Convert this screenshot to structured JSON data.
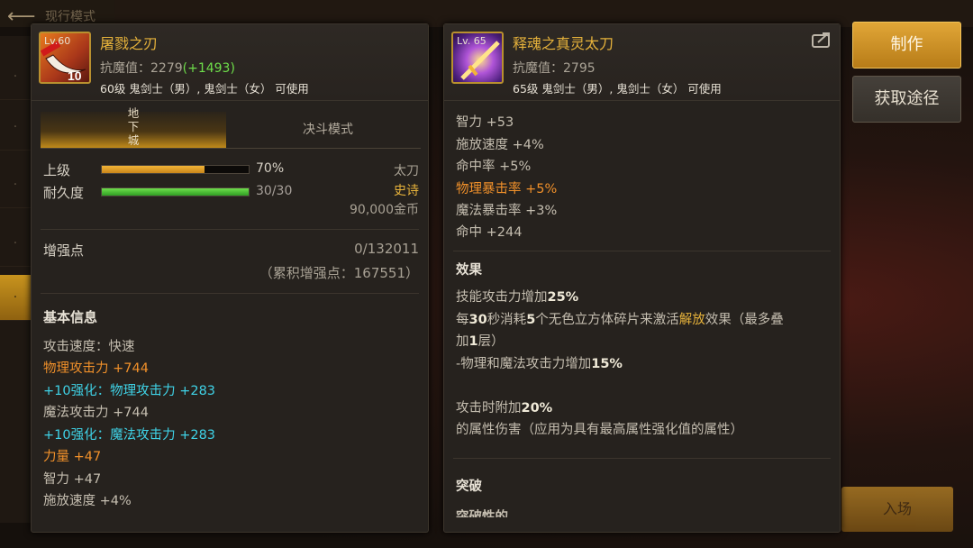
{
  "background": {
    "title": "现行模式",
    "enter_label": "入场"
  },
  "left": {
    "icon_level": "Lv.60",
    "name": "屠戮之刃",
    "resist_label": "抗魔值：",
    "resist_value": "2279",
    "resist_bonus": "(+1493)",
    "usable": "60级 鬼剑士（男）, 鬼剑士（女） 可使用",
    "tabs": {
      "active": "地下城",
      "inactive": "决斗模式"
    },
    "grade_label": "上级",
    "grade_percent": "70%",
    "grade_fraction": 0.7,
    "durability_label": "耐久度",
    "durability_value": "30/30",
    "durability_fraction": 1.0,
    "weapon_type": "太刀",
    "rarity": "史诗",
    "price": "90,000金币",
    "reinforce_label": "增强点",
    "reinforce_value": "0/132011",
    "reinforce_total": "（累积增强点：167551）",
    "basic_info_title": "基本信息",
    "stats": [
      {
        "text": "攻击速度：快速",
        "color": "white"
      },
      {
        "text": "物理攻击力 +744",
        "color": "orange"
      },
      {
        "text": "+10强化：物理攻击力 +283",
        "color": "cyan"
      },
      {
        "text": "魔法攻击力 +744",
        "color": "white"
      },
      {
        "text": "+10强化：魔法攻击力 +283",
        "color": "cyan"
      },
      {
        "text": "力量 +47",
        "color": "orange"
      },
      {
        "text": "智力 +47",
        "color": "white"
      },
      {
        "text": "施放速度 +4%",
        "color": "white"
      }
    ]
  },
  "right": {
    "icon_level": "Lv. 65",
    "name": "释魂之真灵太刀",
    "resist_label": "抗魔值：",
    "resist_value": "2795",
    "usable": "65级 鬼剑士（男）, 鬼剑士（女） 可使用",
    "stats": [
      {
        "text": "智力 +53",
        "color": "white"
      },
      {
        "text": "施放速度 +4%",
        "color": "white"
      },
      {
        "text": "命中率 +5%",
        "color": "white"
      },
      {
        "text": "物理暴击率 +5%",
        "color": "orange"
      },
      {
        "text": "魔法暴击率 +3%",
        "color": "white"
      },
      {
        "text": "命中 +244",
        "color": "white"
      }
    ],
    "effect_title": "效果",
    "effect_line1_a": "技能攻击力增加",
    "effect_line1_b": "25%",
    "effect_line2_a": "每",
    "effect_line2_b": "30",
    "effect_line2_c": "秒消耗",
    "effect_line2_d": "5",
    "effect_line2_e": "个无色立方体碎片来激活",
    "effect_line2_f": "解放",
    "effect_line2_g": "效果（最多叠",
    "effect_line3_a": "加",
    "effect_line3_b": "1",
    "effect_line3_c": "层）",
    "effect_line4_a": "-物理和魔法攻击力增加",
    "effect_line4_b": "15%",
    "effect_line5_a": "攻击时附加",
    "effect_line5_b": "20%",
    "effect_line6": "的属性伤害（应用为具有最高属性强化值的属性）",
    "breakthrough_title": "突破",
    "breakthrough_partial": "突破性的"
  },
  "buttons": {
    "craft": "制作",
    "obtain": "获取途径"
  }
}
